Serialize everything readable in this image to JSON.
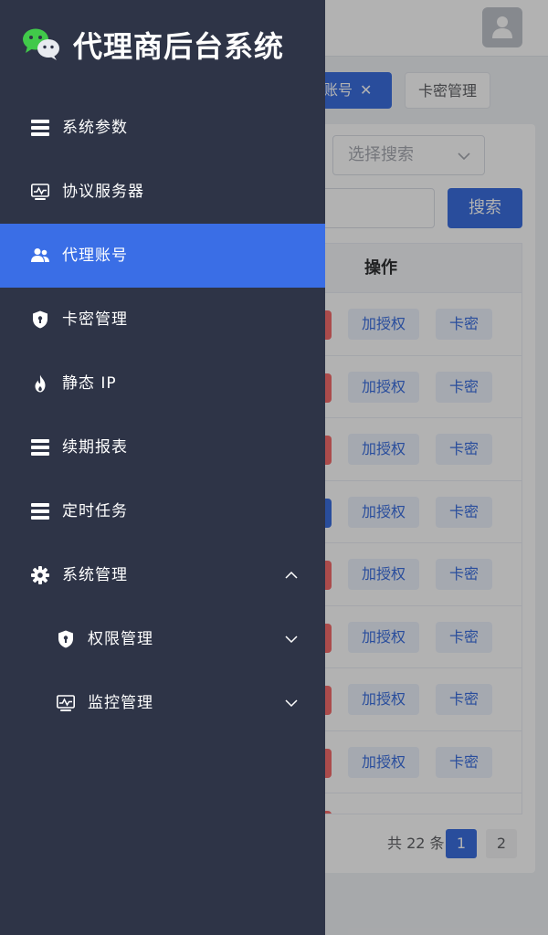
{
  "app": {
    "title": "代理商后台系统"
  },
  "sidebar": {
    "items": [
      {
        "label": "系统参数",
        "icon": "list-icon"
      },
      {
        "label": "协议服务器",
        "icon": "monitor-icon"
      },
      {
        "label": "代理账号",
        "icon": "users-icon",
        "active": true
      },
      {
        "label": "卡密管理",
        "icon": "shield-icon"
      },
      {
        "label": "静态 IP",
        "icon": "fire-icon"
      },
      {
        "label": "续期报表",
        "icon": "list-icon"
      },
      {
        "label": "定时任务",
        "icon": "list-icon"
      },
      {
        "label": "系统管理",
        "icon": "gear-icon",
        "expanded": true
      },
      {
        "label": "权限管理",
        "icon": "shield-icon",
        "sub": true
      },
      {
        "label": "监控管理",
        "icon": "monitor-icon",
        "sub": true
      }
    ]
  },
  "tabs": [
    {
      "label": "账号",
      "active": true,
      "close": "✕"
    },
    {
      "label": "卡密管理",
      "active": false
    }
  ],
  "filter": {
    "select_placeholder": "选择搜索",
    "search_button": "搜索"
  },
  "table": {
    "header": "操作",
    "row_actions": {
      "auth": "加授权",
      "card": "卡密"
    }
  },
  "pagination": {
    "total": "共 22 条",
    "pages": [
      "1",
      "2"
    ],
    "current": "1"
  },
  "colors": {
    "sidebar_bg": "#2e3447",
    "active": "#3a6ee6",
    "primary": "#3b6fe0",
    "danger": "#f56c6c"
  }
}
